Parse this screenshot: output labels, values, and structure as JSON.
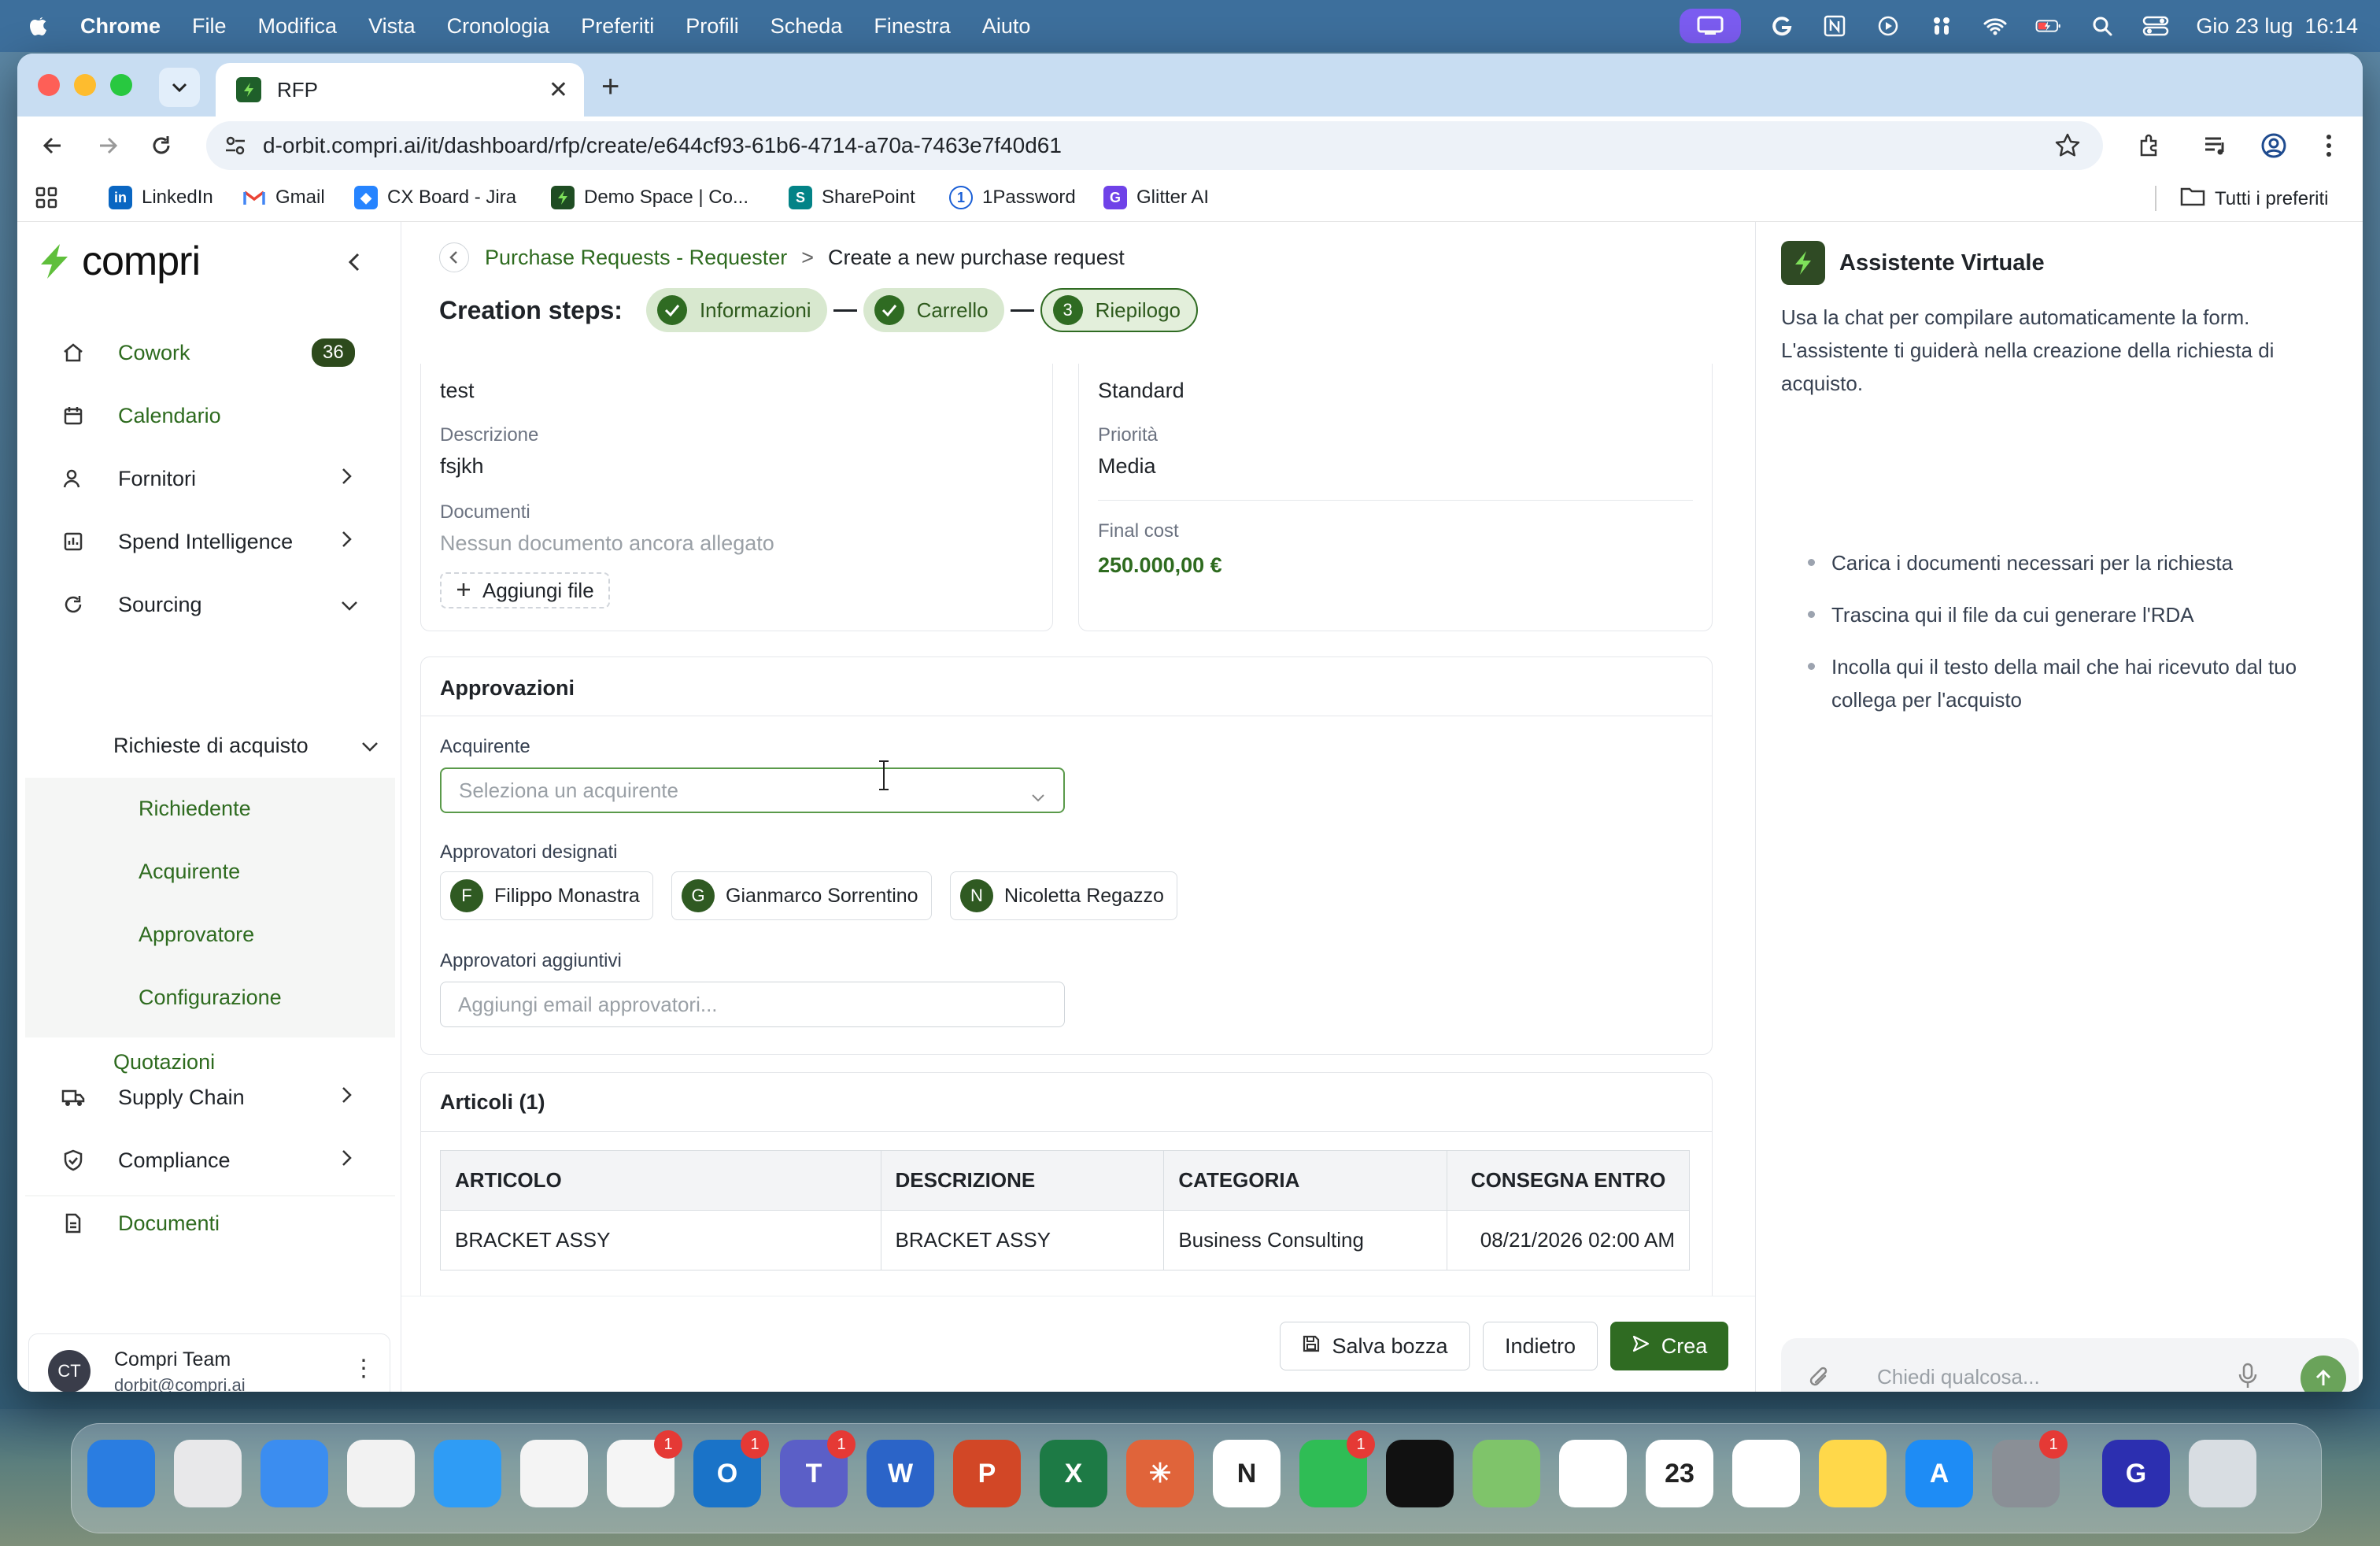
{
  "menubar": {
    "app": "Chrome",
    "items": [
      "File",
      "Modifica",
      "Vista",
      "Cronologia",
      "Preferiti",
      "Profili",
      "Scheda",
      "Finestra",
      "Aiuto"
    ],
    "datetime": "Gio 23 lug  16:14"
  },
  "browser": {
    "tab_title": "RFP",
    "url": "d-orbit.compri.ai/it/dashboard/rfp/create/e644cf93-61b6-4714-a70a-7463e7f40d61",
    "bookmarks": [
      "LinkedIn",
      "Gmail",
      "CX Board - Jira",
      "Demo Space | Co...",
      "SharePoint",
      "1Password",
      "Glitter AI"
    ],
    "all_bookmarks": "Tutti i preferiti"
  },
  "sidebar": {
    "logo": "compri",
    "items": [
      {
        "label": "Cowork",
        "badge": "36"
      },
      {
        "label": "Calendario"
      },
      {
        "label": "Fornitori"
      },
      {
        "label": "Spend Intelligence"
      },
      {
        "label": "Sourcing"
      },
      {
        "label": "Supply Chain"
      },
      {
        "label": "Compliance"
      },
      {
        "label": "Documenti"
      }
    ],
    "sourcing_sub": {
      "group": "Richieste di acquisto",
      "children": [
        "Richiedente",
        "Acquirente",
        "Approvatore",
        "Configurazione"
      ],
      "quotazioni": "Quotazioni"
    },
    "user": {
      "initials": "CT",
      "name": "Compri Team",
      "email": "dorbit@compri.ai"
    }
  },
  "main": {
    "breadcrumb": {
      "parent": "Purchase Requests - Requester",
      "separator": ">",
      "current": "Create a new purchase request"
    },
    "steps_label": "Creation steps:",
    "steps": [
      {
        "label": "Informazioni",
        "done": true
      },
      {
        "label": "Carrello",
        "done": true
      },
      {
        "label": "Riepilogo",
        "number": "3",
        "current": true
      }
    ],
    "info_left": {
      "title_value": "test",
      "description_label": "Descrizione",
      "description_value": "fsjkh",
      "documents_label": "Documenti",
      "documents_empty": "Nessun documento ancora allegato",
      "add_file": "Aggiungi file"
    },
    "info_right": {
      "type_value": "Standard",
      "priority_label": "Priorità",
      "priority_value": "Media",
      "final_cost_label": "Final cost",
      "final_cost_value": "250.000,00 €"
    },
    "approvals": {
      "title": "Approvazioni",
      "buyer_label": "Acquirente",
      "buyer_placeholder": "Seleziona un acquirente",
      "designated_label": "Approvatori designati",
      "approvers": [
        {
          "initial": "F",
          "name": "Filippo Monastra"
        },
        {
          "initial": "G",
          "name": "Gianmarco Sorrentino"
        },
        {
          "initial": "N",
          "name": "Nicoletta Regazzo"
        }
      ],
      "additional_label": "Approvatori aggiuntivi",
      "additional_placeholder": "Aggiungi email approvatori..."
    },
    "articles": {
      "title": "Articoli (1)",
      "columns": [
        "ARTICOLO",
        "DESCRIZIONE",
        "CATEGORIA",
        "CONSEGNA ENTRO"
      ],
      "rows": [
        [
          "BRACKET ASSY",
          "BRACKET ASSY",
          "Business Consulting",
          "08/21/2026 02:00 AM"
        ]
      ]
    },
    "footer": {
      "save_draft": "Salva bozza",
      "back": "Indietro",
      "create": "Crea"
    }
  },
  "assistant": {
    "title": "Assistente Virtuale",
    "description": "Usa la chat per compilare automaticamente la form. L'assistente ti guiderà nella creazione della richiesta di acquisto.",
    "tips": [
      "Carica i documenti necessari per la richiesta",
      "Trascina qui il file da cui generare l'RDA",
      "Incolla qui il testo della mail che hai ricevuto dal tuo collega per l'acquisto"
    ],
    "input_placeholder": "Chiedi qualcosa..."
  },
  "dock": {
    "apps": [
      {
        "name": "finder-app",
        "color": "#2a7de1",
        "glyph": ""
      },
      {
        "name": "launchpad-app",
        "color": "#e8e8ea",
        "glyph": ""
      },
      {
        "name": "mail-app",
        "color": "#3b8df0",
        "glyph": ""
      },
      {
        "name": "toolbar-app",
        "color": "#f2f2f2",
        "glyph": ""
      },
      {
        "name": "safari-app",
        "color": "#2f9cf5",
        "glyph": ""
      },
      {
        "name": "chrome-app",
        "color": "#f4f4f4",
        "glyph": ""
      },
      {
        "name": "slack-app",
        "color": "#f5f5f5",
        "glyph": "",
        "badge": "1"
      },
      {
        "name": "outlook-app",
        "color": "#1a73c8",
        "glyph": "O",
        "badge": "1"
      },
      {
        "name": "teams-app",
        "color": "#5b5fc7",
        "glyph": "T",
        "badge": "1"
      },
      {
        "name": "word-app",
        "color": "#2b64c8",
        "glyph": "W"
      },
      {
        "name": "powerpoint-app",
        "color": "#d24726",
        "glyph": "P"
      },
      {
        "name": "excel-app",
        "color": "#1d7a45",
        "glyph": "X"
      },
      {
        "name": "claude-app",
        "color": "#e0643a",
        "glyph": "✳"
      },
      {
        "name": "notion-app",
        "color": "#ffffff",
        "glyph": "N"
      },
      {
        "name": "whatsapp-app",
        "color": "#2fbd55",
        "glyph": "",
        "badge": "1"
      },
      {
        "name": "spotify-app",
        "color": "#111111",
        "glyph": ""
      },
      {
        "name": "maps-app",
        "color": "#7fc46a",
        "glyph": ""
      },
      {
        "name": "photos-app",
        "color": "#ffffff",
        "glyph": ""
      },
      {
        "name": "calendar-app",
        "color": "#ffffff",
        "glyph": "23"
      },
      {
        "name": "reminders-app",
        "color": "#ffffff",
        "glyph": ""
      },
      {
        "name": "notes-app",
        "color": "#ffd84a",
        "glyph": ""
      },
      {
        "name": "appstore-app",
        "color": "#1e8cf5",
        "glyph": "A"
      },
      {
        "name": "settings-app",
        "color": "#8a8f96",
        "glyph": "",
        "badge": "1"
      },
      {
        "name": "glitter-app",
        "color": "#2c2fb0",
        "glyph": "G"
      },
      {
        "name": "trash-app",
        "color": "#d8dde2",
        "glyph": ""
      }
    ]
  }
}
